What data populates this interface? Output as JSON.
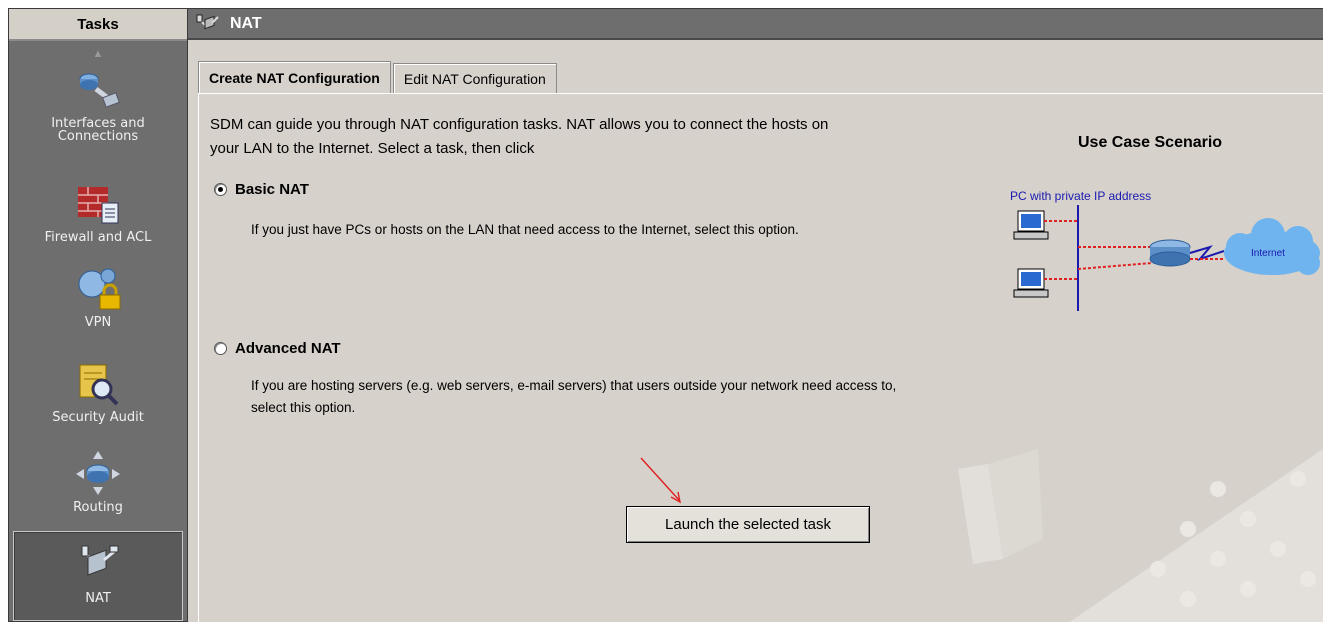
{
  "sidebar": {
    "header": "Tasks",
    "items": [
      {
        "label": "Interfaces and Connections",
        "icon": "interfaces-icon"
      },
      {
        "label": "Firewall and ACL",
        "icon": "firewall-icon"
      },
      {
        "label": "VPN",
        "icon": "vpn-icon"
      },
      {
        "label": "Security Audit",
        "icon": "security-audit-icon"
      },
      {
        "label": "Routing",
        "icon": "routing-icon"
      },
      {
        "label": "NAT",
        "icon": "nat-icon",
        "selected": true
      }
    ]
  },
  "window": {
    "title": "NAT"
  },
  "tabs": [
    {
      "label": "Create NAT Configuration",
      "active": true
    },
    {
      "label": "Edit NAT Configuration",
      "active": false
    }
  ],
  "content": {
    "intro": "SDM can guide you through NAT configuration tasks. NAT allows you to connect the hosts on your LAN to the Internet. Select a task, then click",
    "options": [
      {
        "label": "Basic NAT",
        "checked": true,
        "description": "If you just have PCs or hosts on the LAN that need access to the Internet, select this option."
      },
      {
        "label": "Advanced NAT",
        "checked": false,
        "description": "If you are hosting servers (e.g. web servers, e-mail servers) that users outside your network need access to, select this option."
      }
    ],
    "launch_button": "Launch the selected task"
  },
  "use_case": {
    "title": "Use Case Scenario",
    "pc_label": "PC with private IP address",
    "cloud_label": "Internet"
  },
  "colors": {
    "sidebar_bg": "#6e6e6e",
    "panel_bg": "#d6d1cb",
    "link_blue": "#1a1ab0",
    "arrow_red": "#e02020"
  }
}
